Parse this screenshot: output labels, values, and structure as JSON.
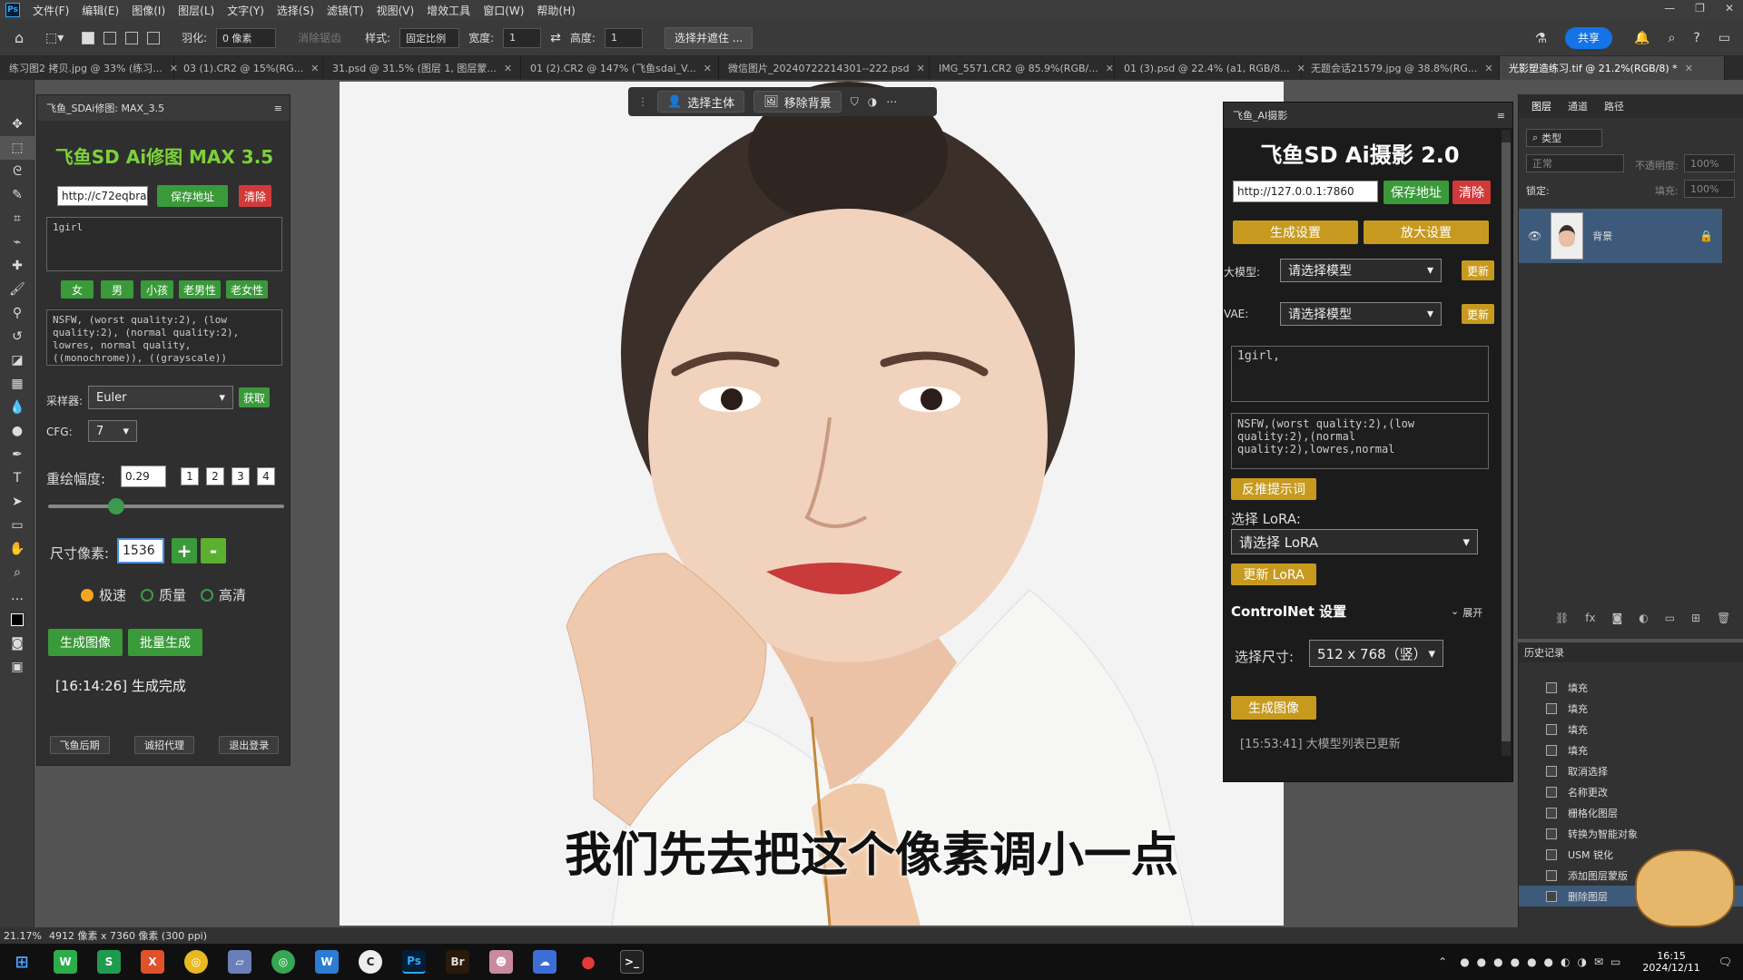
{
  "menubar": {
    "ps_logo": "Ps",
    "items": [
      "文件(F)",
      "编辑(E)",
      "图像(I)",
      "图层(L)",
      "文字(Y)",
      "选择(S)",
      "滤镜(T)",
      "视图(V)",
      "增效工具",
      "窗口(W)",
      "帮助(H)"
    ]
  },
  "optionsbar": {
    "feather_label": "羽化:",
    "feather_value": "0 像素",
    "antialias_label": "消除锯齿",
    "style_label": "样式:",
    "style_value": "固定比例",
    "width_label": "宽度:",
    "width_value": "1",
    "height_label": "高度:",
    "height_value": "1",
    "select_mask_label": "选择并遮住 ...",
    "share_label": "共享"
  },
  "tabs": [
    "练习图2 拷贝.jpg @ 33% (练习...",
    "03 (1).CR2 @ 15%(RG...",
    "31.psd @ 31.5% (图层 1, 图层蒙...",
    "01 (2).CR2 @ 147% (飞鱼sdai_V...",
    "微信图片_20240722214301--222.psd",
    "IMG_5571.CR2 @ 85.9%(RGB/...",
    "01 (3).psd @ 22.4% (a1, RGB/8...",
    "无题会话21579.jpg @ 38.8%(RG...",
    "光影塑造练习.tif @ 21.2%(RGB/8) *"
  ],
  "floatbar": {
    "select_subject": "选择主体",
    "remove_bg": "移除背景"
  },
  "leftpanel": {
    "tab_title": "飞鱼_SDAi修图: MAX_3.5",
    "heading": "飞鱼SD Ai修图 MAX 3.5",
    "url_value": "http://c72eqbral",
    "save_addr": "保存地址",
    "clear": "清除",
    "prompt": "1girl",
    "tags": [
      "女",
      "男",
      "小孩",
      "老男性",
      "老女性"
    ],
    "neg_prompt": "NSFW, (worst quality:2), (low quality:2), (normal quality:2), lowres, normal quality, ((monochrome)), ((grayscale))",
    "sampler_label": "采样器:",
    "sampler_value": "Euler",
    "fetch": "获取",
    "cfg_label": "CFG:",
    "cfg_value": "7",
    "redraw_label": "重绘幅度:",
    "redraw_value": "0.29",
    "presets": [
      "1",
      "2",
      "3",
      "4"
    ],
    "slider_level": 0.29,
    "size_label": "尺寸像素:",
    "size_value": "1536",
    "plus": "+",
    "minus": "-",
    "modes": [
      "极速",
      "质量",
      "高清"
    ],
    "gen_btn": "生成图像",
    "batch_btn": "批量生成",
    "status": "[16:14:26] 生成完成",
    "footer": [
      "飞鱼后期",
      "诚招代理",
      "退出登录"
    ]
  },
  "rightpanel": {
    "tab_title": "飞鱼_AI摄影",
    "heading": "飞鱼SD Ai摄影 2.0",
    "url_value": "http://127.0.0.1:7860",
    "save_addr": "保存地址",
    "clear": "清除",
    "gen_settings": "生成设置",
    "upscale_settings": "放大设置",
    "model_label": "大模型:",
    "model_value": "请选择模型",
    "update": "更新",
    "vae_label": "VAE:",
    "vae_value": "请选择模型",
    "prompt": "1girl,",
    "neg_prompt": "NSFW,(worst quality:2),(low quality:2),(normal quality:2),lowres,normal",
    "reverse_prompt": "反推提示词",
    "lora_label": "选择 LoRA:",
    "lora_value": "请选择 LoRA",
    "update_lora": "更新 LoRA",
    "controlnet_label": "ControlNet 设置",
    "expand": "展开",
    "size_label": "选择尺寸:",
    "size_value": "512 x 768（竖）",
    "gen_btn": "生成图像",
    "status": "[15:53:41] 大模型列表已更新"
  },
  "layers": {
    "tabs": [
      "图层",
      "通道",
      "路径"
    ],
    "search_placeholder": "类型",
    "blend_mode": "正常",
    "opacity_label": "不透明度:",
    "opacity_value": "100%",
    "lock_label": "锁定:",
    "fill_label": "填充:",
    "fill_value": "100%",
    "layer_name": "背景"
  },
  "history": {
    "title": "历史记录",
    "items": [
      "填充",
      "填充",
      "填充",
      "填充",
      "取消选择",
      "名称更改",
      "栅格化图层",
      "转换为智能对象",
      "USM 锐化",
      "添加图层蒙版",
      "删除图层"
    ]
  },
  "subtitle": "我们先去把这个像素调小一点",
  "statusbar": {
    "zoom": "21.17%",
    "info": "4912 像素 x 7360 像素 (300 ppi)"
  },
  "taskbar": {
    "time": "16:15",
    "date": "2024/12/11",
    "apps": [
      "WeChat",
      "S",
      "X",
      "Chrome",
      "Files",
      "Chrome2",
      "Word",
      "C",
      "Ps",
      "Br",
      "Avatar",
      "Cloud",
      "Rec",
      "Term"
    ]
  }
}
